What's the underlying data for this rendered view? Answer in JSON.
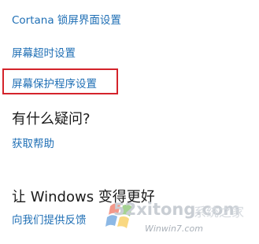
{
  "links": {
    "cortana_lock": "Cortana 锁屏界面设置",
    "screen_timeout": "屏幕超时设置",
    "screensaver": "屏幕保护程序设置",
    "get_help": "获取帮助",
    "feedback": "向我们提供反馈"
  },
  "sections": {
    "questions_heading": "有什么疑问?",
    "better_heading": "让 Windows 变得更好"
  },
  "watermark": {
    "site": "52xitong.com",
    "sub": "系统之家",
    "url": "Winwin7.com"
  },
  "colors": {
    "link": "#1f6fb5",
    "highlight": "#d4232b"
  }
}
